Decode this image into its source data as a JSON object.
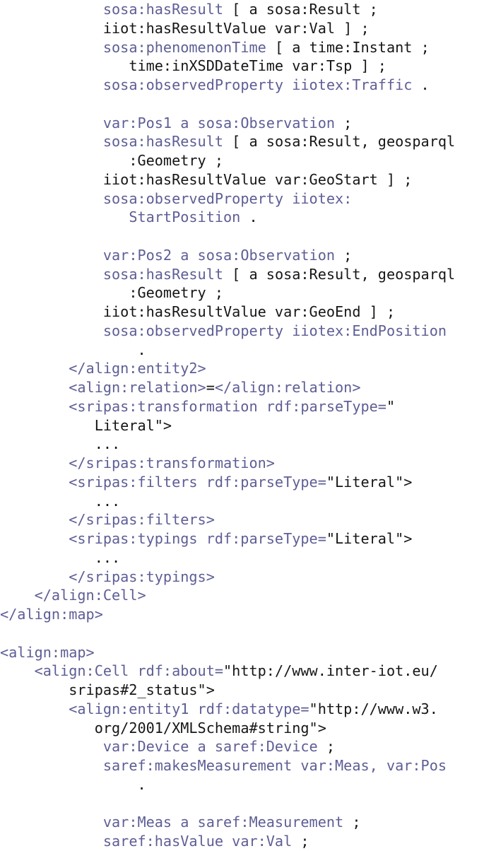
{
  "document": {
    "kind": "code-listing",
    "language": "rdf-xml-with-turtle",
    "colors": {
      "background": "#ffffff",
      "plain_text": "#161616",
      "keyword_text": "#5e5e96"
    },
    "lines": [
      {
        "indent": 12,
        "spans": [
          {
            "text": "sosa:hasResult",
            "style": "kw"
          },
          {
            "text": " [ a sosa:Result ;",
            "style": "plain"
          }
        ]
      },
      {
        "indent": 12,
        "spans": [
          {
            "text": "iiot:hasResultValue var:Val ] ;",
            "style": "plain"
          }
        ]
      },
      {
        "indent": 12,
        "spans": [
          {
            "text": "sosa:phenomenonTime",
            "style": "kw"
          },
          {
            "text": " [ a time:Instant ;",
            "style": "plain"
          }
        ]
      },
      {
        "indent": 15,
        "spans": [
          {
            "text": "time:inXSDDateTime var:Tsp ] ;",
            "style": "plain"
          }
        ]
      },
      {
        "indent": 12,
        "spans": [
          {
            "text": "sosa:observedProperty iiotex:Traffic",
            "style": "kw"
          },
          {
            "text": " .",
            "style": "plain"
          }
        ]
      },
      {
        "indent": 0,
        "spans": []
      },
      {
        "indent": 12,
        "spans": [
          {
            "text": "var:Pos1 a sosa:Observation",
            "style": "kw"
          },
          {
            "text": " ;",
            "style": "plain"
          }
        ]
      },
      {
        "indent": 12,
        "spans": [
          {
            "text": "sosa:hasResult",
            "style": "kw"
          },
          {
            "text": " [ a sosa:Result, geosparql",
            "style": "plain"
          }
        ]
      },
      {
        "indent": 15,
        "spans": [
          {
            "text": ":Geometry ;",
            "style": "plain"
          }
        ]
      },
      {
        "indent": 12,
        "spans": [
          {
            "text": "iiot:hasResultValue var:GeoStart ] ;",
            "style": "plain"
          }
        ]
      },
      {
        "indent": 12,
        "spans": [
          {
            "text": "sosa:observedProperty iiotex:",
            "style": "kw"
          }
        ]
      },
      {
        "indent": 15,
        "spans": [
          {
            "text": "StartPosition",
            "style": "kw"
          },
          {
            "text": " .",
            "style": "plain"
          }
        ]
      },
      {
        "indent": 0,
        "spans": []
      },
      {
        "indent": 12,
        "spans": [
          {
            "text": "var:Pos2 a sosa:Observation",
            "style": "kw"
          },
          {
            "text": " ;",
            "style": "plain"
          }
        ]
      },
      {
        "indent": 12,
        "spans": [
          {
            "text": "sosa:hasResult",
            "style": "kw"
          },
          {
            "text": " [ a sosa:Result, geosparql",
            "style": "plain"
          }
        ]
      },
      {
        "indent": 15,
        "spans": [
          {
            "text": ":Geometry ;",
            "style": "plain"
          }
        ]
      },
      {
        "indent": 12,
        "spans": [
          {
            "text": "iiot:hasResultValue var:GeoEnd ] ;",
            "style": "plain"
          }
        ]
      },
      {
        "indent": 12,
        "spans": [
          {
            "text": "sosa:observedProperty iiotex:EndPosition",
            "style": "kw"
          }
        ]
      },
      {
        "indent": 16,
        "spans": [
          {
            "text": ".",
            "style": "plain"
          }
        ]
      },
      {
        "indent": 8,
        "spans": [
          {
            "text": "</align:entity2>",
            "style": "kw"
          }
        ]
      },
      {
        "indent": 8,
        "spans": [
          {
            "text": "<align:relation>",
            "style": "kw"
          },
          {
            "text": "=",
            "style": "plain"
          },
          {
            "text": "</align:relation>",
            "style": "kw"
          }
        ]
      },
      {
        "indent": 8,
        "spans": [
          {
            "text": "<sripas:transformation rdf:parseType=",
            "style": "kw"
          },
          {
            "text": "\"",
            "style": "plain"
          }
        ]
      },
      {
        "indent": 11,
        "spans": [
          {
            "text": "Literal\">",
            "style": "plain"
          }
        ]
      },
      {
        "indent": 11,
        "spans": [
          {
            "text": "...",
            "style": "plain"
          }
        ]
      },
      {
        "indent": 8,
        "spans": [
          {
            "text": "</sripas:transformation>",
            "style": "kw"
          }
        ]
      },
      {
        "indent": 8,
        "spans": [
          {
            "text": "<sripas:filters rdf:parseType=",
            "style": "kw"
          },
          {
            "text": "\"Literal\">",
            "style": "plain"
          }
        ]
      },
      {
        "indent": 11,
        "spans": [
          {
            "text": "...",
            "style": "plain"
          }
        ]
      },
      {
        "indent": 8,
        "spans": [
          {
            "text": "</sripas:filters>",
            "style": "kw"
          }
        ]
      },
      {
        "indent": 8,
        "spans": [
          {
            "text": "<sripas:typings rdf:parseType=",
            "style": "kw"
          },
          {
            "text": "\"Literal\">",
            "style": "plain"
          }
        ]
      },
      {
        "indent": 11,
        "spans": [
          {
            "text": "...",
            "style": "plain"
          }
        ]
      },
      {
        "indent": 8,
        "spans": [
          {
            "text": "</sripas:typings>",
            "style": "kw"
          }
        ]
      },
      {
        "indent": 4,
        "spans": [
          {
            "text": "</align:Cell>",
            "style": "kw"
          }
        ]
      },
      {
        "indent": 0,
        "spans": [
          {
            "text": "</align:map>",
            "style": "kw"
          }
        ]
      },
      {
        "indent": 0,
        "spans": []
      },
      {
        "indent": 0,
        "spans": [
          {
            "text": "<align:map>",
            "style": "kw"
          }
        ]
      },
      {
        "indent": 4,
        "spans": [
          {
            "text": "<align:Cell rdf:about=",
            "style": "kw"
          },
          {
            "text": "\"http://www.inter-iot.eu/",
            "style": "plain"
          }
        ]
      },
      {
        "indent": 8,
        "spans": [
          {
            "text": "sripas#2_status\">",
            "style": "plain"
          }
        ]
      },
      {
        "indent": 8,
        "spans": [
          {
            "text": "<align:entity1 rdf:datatype=",
            "style": "kw"
          },
          {
            "text": "\"http://www.w3.",
            "style": "plain"
          }
        ]
      },
      {
        "indent": 11,
        "spans": [
          {
            "text": "org/2001/XMLSchema#string\">",
            "style": "plain"
          }
        ]
      },
      {
        "indent": 12,
        "spans": [
          {
            "text": "var:Device a saref:Device",
            "style": "kw"
          },
          {
            "text": " ;",
            "style": "plain"
          }
        ]
      },
      {
        "indent": 12,
        "spans": [
          {
            "text": "saref:makesMeasurement var:Meas, var:Pos",
            "style": "kw"
          }
        ]
      },
      {
        "indent": 16,
        "spans": [
          {
            "text": ".",
            "style": "plain"
          }
        ]
      },
      {
        "indent": 0,
        "spans": []
      },
      {
        "indent": 12,
        "spans": [
          {
            "text": "var:Meas a saref:Measurement",
            "style": "kw"
          },
          {
            "text": " ;",
            "style": "plain"
          }
        ]
      },
      {
        "indent": 12,
        "spans": [
          {
            "text": "saref:hasValue var:Val",
            "style": "kw"
          },
          {
            "text": " ;",
            "style": "plain"
          }
        ]
      }
    ]
  }
}
